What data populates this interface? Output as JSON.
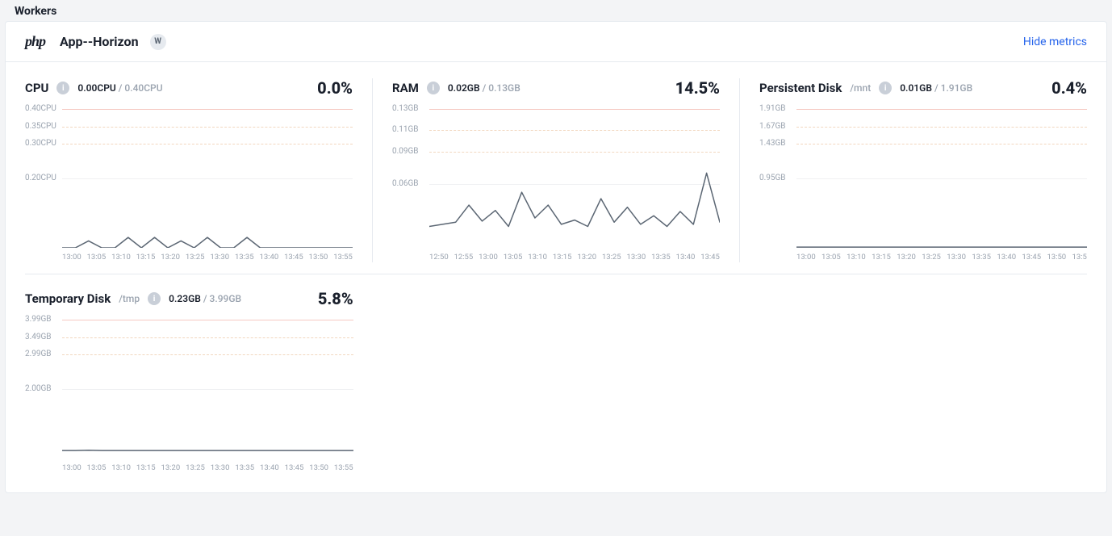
{
  "section": {
    "title": "Workers"
  },
  "card": {
    "logo": "php",
    "title": "App--Horizon",
    "badge": "W",
    "hide_label": "Hide metrics"
  },
  "metrics": [
    {
      "id": "cpu",
      "title": "CPU",
      "subtitle": null,
      "used": "0.00CPU",
      "max": "0.40CPU",
      "pct": "0.0%"
    },
    {
      "id": "ram",
      "title": "RAM",
      "subtitle": null,
      "used": "0.02GB",
      "max": "0.13GB",
      "pct": "14.5%"
    },
    {
      "id": "persistent-disk",
      "title": "Persistent Disk",
      "subtitle": "/mnt",
      "used": "0.01GB",
      "max": "1.91GB",
      "pct": "0.4%"
    },
    {
      "id": "temp-disk",
      "title": "Temporary Disk",
      "subtitle": "/tmp",
      "used": "0.23GB",
      "max": "3.99GB",
      "pct": "5.8%"
    }
  ],
  "chart_data": [
    {
      "type": "line",
      "title": "CPU",
      "ylabel": "CPU",
      "unit": "CPU",
      "ylim": [
        0,
        0.4
      ],
      "yticks": [
        {
          "v": 0.4,
          "label": "0.40CPU",
          "style": "max"
        },
        {
          "v": 0.35,
          "label": "0.35CPU",
          "style": "dash"
        },
        {
          "v": 0.3,
          "label": "0.30CPU",
          "style": "dash"
        },
        {
          "v": 0.2,
          "label": "0.20CPU",
          "style": "plain"
        }
      ],
      "x": [
        "13:00",
        "13:05",
        "13:10",
        "13:15",
        "13:20",
        "13:25",
        "13:30",
        "13:35",
        "13:40",
        "13:45",
        "13:50",
        "13:55"
      ],
      "values": [
        0.0,
        0.0,
        0.02,
        0.0,
        0.0,
        0.03,
        0.0,
        0.03,
        0.0,
        0.02,
        0.0,
        0.03,
        0.0,
        0.0,
        0.03,
        0.0,
        0.0,
        0.0,
        0.0,
        0.0,
        0.0,
        0.0,
        0.0
      ]
    },
    {
      "type": "line",
      "title": "RAM",
      "ylabel": "GB",
      "unit": "GB",
      "ylim": [
        0,
        0.13
      ],
      "yticks": [
        {
          "v": 0.13,
          "label": "0.13GB",
          "style": "max"
        },
        {
          "v": 0.11,
          "label": "0.11GB",
          "style": "dash"
        },
        {
          "v": 0.09,
          "label": "0.09GB",
          "style": "dash"
        },
        {
          "v": 0.06,
          "label": "0.06GB",
          "style": "plain"
        }
      ],
      "x": [
        "12:50",
        "12:55",
        "13:00",
        "13:05",
        "13:10",
        "13:15",
        "13:20",
        "13:25",
        "13:30",
        "13:35",
        "13:40",
        "13:45"
      ],
      "values": [
        0.02,
        0.022,
        0.024,
        0.04,
        0.025,
        0.035,
        0.02,
        0.052,
        0.028,
        0.04,
        0.022,
        0.026,
        0.02,
        0.046,
        0.024,
        0.038,
        0.022,
        0.03,
        0.02,
        0.034,
        0.022,
        0.07,
        0.024
      ]
    },
    {
      "type": "line",
      "title": "Persistent Disk",
      "ylabel": "GB",
      "unit": "GB",
      "ylim": [
        0,
        1.91
      ],
      "yticks": [
        {
          "v": 1.91,
          "label": "1.91GB",
          "style": "max"
        },
        {
          "v": 1.67,
          "label": "1.67GB",
          "style": "dash"
        },
        {
          "v": 1.43,
          "label": "1.43GB",
          "style": "dash"
        },
        {
          "v": 0.95,
          "label": "0.95GB",
          "style": "plain"
        }
      ],
      "x": [
        "13:00",
        "13:05",
        "13:10",
        "13:15",
        "13:20",
        "13:25",
        "13:30",
        "13:35",
        "13:40",
        "13:45",
        "13:50",
        "13:5"
      ],
      "values": [
        0.01,
        0.01,
        0.01,
        0.01,
        0.01,
        0.01,
        0.01,
        0.01,
        0.01,
        0.01,
        0.01,
        0.01,
        0.01,
        0.01,
        0.01,
        0.01,
        0.01,
        0.01,
        0.01,
        0.01,
        0.01,
        0.01,
        0.01
      ]
    },
    {
      "type": "line",
      "title": "Temporary Disk",
      "ylabel": "GB",
      "unit": "GB",
      "ylim": [
        0,
        3.99
      ],
      "yticks": [
        {
          "v": 3.99,
          "label": "3.99GB",
          "style": "max"
        },
        {
          "v": 3.49,
          "label": "3.49GB",
          "style": "dash"
        },
        {
          "v": 2.99,
          "label": "2.99GB",
          "style": "dash"
        },
        {
          "v": 2.0,
          "label": "2.00GB",
          "style": "plain"
        }
      ],
      "x": [
        "13:00",
        "13:05",
        "13:10",
        "13:15",
        "13:20",
        "13:25",
        "13:30",
        "13:35",
        "13:40",
        "13:45",
        "13:50",
        "13:55"
      ],
      "values": [
        0.23,
        0.23,
        0.24,
        0.23,
        0.23,
        0.23,
        0.23,
        0.23,
        0.23,
        0.23,
        0.23,
        0.23,
        0.23,
        0.23,
        0.23,
        0.23,
        0.23,
        0.23,
        0.23,
        0.23,
        0.23,
        0.23,
        0.23
      ]
    }
  ]
}
